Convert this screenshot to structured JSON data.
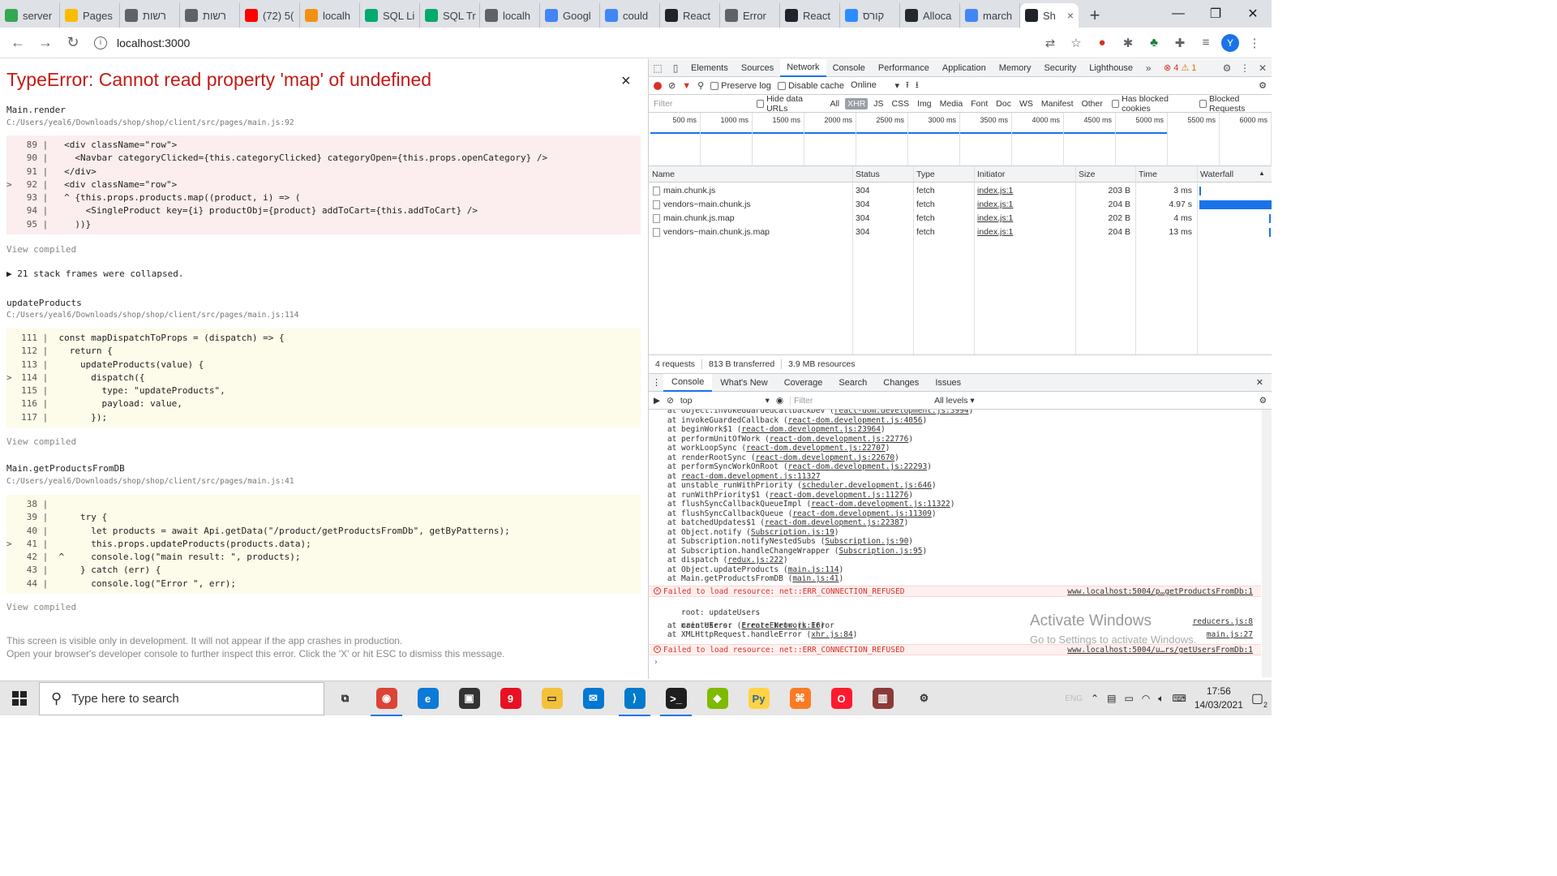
{
  "browser": {
    "tabs": [
      {
        "label": "server",
        "icon": "google-drive-icon",
        "color": "#34a853"
      },
      {
        "label": "Pages",
        "icon": "google-drive-icon",
        "color": "#fbbc04"
      },
      {
        "label": "רשות",
        "icon": "globe-icon",
        "color": "#5f6368"
      },
      {
        "label": "רשות",
        "icon": "globe-icon",
        "color": "#5f6368"
      },
      {
        "label": "(72) 5(",
        "icon": "youtube-icon",
        "color": "#ff0000"
      },
      {
        "label": "localh",
        "icon": "phpmyadmin-icon",
        "color": "#f29111"
      },
      {
        "label": "SQL Li",
        "icon": "w3schools-icon",
        "color": "#04aa6d"
      },
      {
        "label": "SQL Tr",
        "icon": "w3schools-icon",
        "color": "#04aa6d"
      },
      {
        "label": "localh",
        "icon": "globe-icon",
        "color": "#5f6368"
      },
      {
        "label": "Googl",
        "icon": "google-translate-icon",
        "color": "#4285f4"
      },
      {
        "label": "could",
        "icon": "google-icon",
        "color": "#4285f4"
      },
      {
        "label": "React",
        "icon": "react-icon",
        "color": "#20232a"
      },
      {
        "label": "Error",
        "icon": "globe-icon",
        "color": "#5f6368"
      },
      {
        "label": "React",
        "icon": "react-icon",
        "color": "#20232a"
      },
      {
        "label": "קורס",
        "icon": "zoom-icon",
        "color": "#2d8cff"
      },
      {
        "label": "Alloca",
        "icon": "github-icon",
        "color": "#24292e"
      },
      {
        "label": "march",
        "icon": "google-icon",
        "color": "#4285f4"
      },
      {
        "label": "Sh",
        "icon": "react-icon",
        "color": "#20232a",
        "active": true
      }
    ],
    "url": "localhost:3000",
    "profile_initial": "Y"
  },
  "overlay": {
    "title": "TypeError: Cannot read property 'map' of undefined",
    "close_glyph": "×",
    "frames": [
      {
        "name": "Main.render",
        "path": "C:/Users/yeal6/Downloads/shop/shop/client/src/pages/main.js:92",
        "style": "red",
        "lines": [
          {
            "ln": "89",
            "mark": "",
            "code": "  <div className=\"row\">"
          },
          {
            "ln": "90",
            "mark": "",
            "code": "    <Navbar categoryClicked={this.categoryClicked} categoryOpen={this.props.openCategory} />"
          },
          {
            "ln": "91",
            "mark": "",
            "code": "  </div>"
          },
          {
            "ln": "92",
            "mark": ">",
            "code": "  <div className=\"row\">"
          },
          {
            "ln": "93",
            "mark": "",
            "code": "  ^ {this.props.products.map((product, i) => ("
          },
          {
            "ln": "94",
            "mark": "",
            "code": "      <SingleProduct key={i} productObj={product} addToCart={this.addToCart} />"
          },
          {
            "ln": "95",
            "mark": "",
            "code": "    ))}"
          }
        ]
      },
      {
        "name": "updateProducts",
        "path": "C:/Users/yeal6/Downloads/shop/shop/client/src/pages/main.js:114",
        "style": "yellow",
        "lines": [
          {
            "ln": "111",
            "mark": "",
            "code": " const mapDispatchToProps = (dispatch) => {"
          },
          {
            "ln": "112",
            "mark": "",
            "code": "   return {"
          },
          {
            "ln": "113",
            "mark": "",
            "code": "     updateProducts(value) {"
          },
          {
            "ln": "114",
            "mark": ">",
            "code": "       dispatch({"
          },
          {
            "ln": "115",
            "mark": "",
            "code": "         type: \"updateProducts\","
          },
          {
            "ln": "116",
            "mark": "",
            "code": "         payload: value,"
          },
          {
            "ln": "117",
            "mark": "",
            "code": "       });"
          }
        ]
      },
      {
        "name": "Main.getProductsFromDB",
        "path": "C:/Users/yeal6/Downloads/shop/shop/client/src/pages/main.js:41",
        "style": "yellow",
        "lines": [
          {
            "ln": "38",
            "mark": "",
            "code": ""
          },
          {
            "ln": "39",
            "mark": "",
            "code": "     try {"
          },
          {
            "ln": "40",
            "mark": "",
            "code": "       let products = await Api.getData(\"/product/getProductsFromDb\", getByPatterns);"
          },
          {
            "ln": "41",
            "mark": ">",
            "code": "       this.props.updateProducts(products.data);"
          },
          {
            "ln": "42",
            "mark": "",
            "code": " ^     console.log(\"main result: \", products);"
          },
          {
            "ln": "43",
            "mark": "",
            "code": "     } catch (err) {"
          },
          {
            "ln": "44",
            "mark": "",
            "code": "       console.log(\"Error \", err);"
          }
        ]
      }
    ],
    "view_compiled": "View compiled",
    "collapsed": "▶ 21 stack frames were collapsed.",
    "footer_line1": "This screen is visible only in development. It will not appear if the app crashes in production.",
    "footer_line2": "Open your browser's developer console to further inspect this error.  Click the 'X' or hit ESC to dismiss this message."
  },
  "devtools": {
    "tabs": [
      "Elements",
      "Sources",
      "Network",
      "Console",
      "Performance",
      "Application",
      "Memory",
      "Security",
      "Lighthouse"
    ],
    "active_tab": "Network",
    "more_glyph": "»",
    "error_count": "4",
    "warning_count": "1",
    "net_toolbar": {
      "preserve_log": "Preserve log",
      "disable_cache": "Disable cache",
      "throttle": "Online"
    },
    "filter_row": {
      "placeholder": "Filter",
      "hide_data_urls": "Hide data URLs",
      "types": [
        "All",
        "XHR",
        "JS",
        "CSS",
        "Img",
        "Media",
        "Font",
        "Doc",
        "WS",
        "Manifest",
        "Other"
      ],
      "selected_type": "XHR",
      "has_blocked_cookies": "Has blocked cookies",
      "blocked_requests": "Blocked Requests"
    },
    "timeline_ticks": [
      "500 ms",
      "1000 ms",
      "1500 ms",
      "2000 ms",
      "2500 ms",
      "3000 ms",
      "3500 ms",
      "4000 ms",
      "4500 ms",
      "5000 ms",
      "5500 ms",
      "6000 ms"
    ],
    "table": {
      "headers": [
        "Name",
        "Status",
        "Type",
        "Initiator",
        "Size",
        "Time",
        "Waterfall"
      ],
      "rows": [
        {
          "name": "main.chunk.js",
          "status": "304",
          "type": "fetch",
          "initiator": "index.js:1",
          "size": "203 B",
          "time": "3 ms"
        },
        {
          "name": "vendors~main.chunk.js",
          "status": "304",
          "type": "fetch",
          "initiator": "index.js:1",
          "size": "204 B",
          "time": "4.97 s"
        },
        {
          "name": "main.chunk.js.map",
          "status": "304",
          "type": "fetch",
          "initiator": "index.js:1",
          "size": "202 B",
          "time": "4 ms"
        },
        {
          "name": "vendors~main.chunk.js.map",
          "status": "304",
          "type": "fetch",
          "initiator": "index.js:1",
          "size": "204 B",
          "time": "13 ms"
        }
      ]
    },
    "summary": [
      "4 requests",
      "813 B transferred",
      "3.9 MB resources"
    ],
    "drawer_tabs": [
      "Console",
      "What's New",
      "Coverage",
      "Search",
      "Changes",
      "Issues"
    ],
    "console_toolbar": {
      "context": "top",
      "filter_placeholder": "Filter",
      "levels": "All levels ▾"
    },
    "stack_lines": [
      {
        "pre": "    at Object.invokeGuardedCallbackDev (",
        "link": "react-dom.development.js:3994",
        "post": ")"
      },
      {
        "pre": "    at invokeGuardedCallback (",
        "link": "react-dom.development.js:4056",
        "post": ")"
      },
      {
        "pre": "    at beginWork$1 (",
        "link": "react-dom.development.js:23964",
        "post": ")"
      },
      {
        "pre": "    at performUnitOfWork (",
        "link": "react-dom.development.js:22776",
        "post": ")"
      },
      {
        "pre": "    at workLoopSync (",
        "link": "react-dom.development.js:22707",
        "post": ")"
      },
      {
        "pre": "    at renderRootSync (",
        "link": "react-dom.development.js:22670",
        "post": ")"
      },
      {
        "pre": "    at performSyncWorkOnRoot (",
        "link": "react-dom.development.js:22293",
        "post": ")"
      },
      {
        "pre": "    at ",
        "link": "react-dom.development.js:11327",
        "post": ""
      },
      {
        "pre": "    at unstable_runWithPriority (",
        "link": "scheduler.development.js:646",
        "post": ")"
      },
      {
        "pre": "    at runWithPriority$1 (",
        "link": "react-dom.development.js:11276",
        "post": ")"
      },
      {
        "pre": "    at flushSyncCallbackQueueImpl (",
        "link": "react-dom.development.js:11322",
        "post": ")"
      },
      {
        "pre": "    at flushSyncCallbackQueue (",
        "link": "react-dom.development.js:11309",
        "post": ")"
      },
      {
        "pre": "    at batchedUpdates$1 (",
        "link": "react-dom.development.js:22387",
        "post": ")"
      },
      {
        "pre": "    at Object.notify (",
        "link": "Subscription.js:19",
        "post": ")"
      },
      {
        "pre": "    at Subscription.notifyNestedSubs (",
        "link": "Subscription.js:90",
        "post": ")"
      },
      {
        "pre": "    at Subscription.handleChangeWrapper (",
        "link": "Subscription.js:95",
        "post": ")"
      },
      {
        "pre": "    at dispatch (",
        "link": "redux.js:222",
        "post": ")"
      },
      {
        "pre": "    at Object.updateProducts (",
        "link": "main.js:114",
        "post": ")"
      },
      {
        "pre": "    at Main.getProductsFromDB (",
        "link": "main.js:41",
        "post": ")"
      }
    ],
    "errors": [
      {
        "msg": "Failed to load resource: net::ERR_CONNECTION_REFUSED",
        "src": "www.localhost:5004/p…getProductsFromDb:1"
      },
      {
        "msg": "Failed to load resource: net::ERR_CONNECTION_REFUSED",
        "src": "www.localhost:5004/u…rs/getUsersFromDb:1"
      }
    ],
    "log_root": {
      "text": " root: updateUsers",
      "src": "reducers.js:8"
    },
    "log_main": {
      "text": " main Users:  Error: Network Error",
      "src": "main.js:27",
      "l2_pre": "    at createError (",
      "l2_link": "createError.js:16",
      "l2_post": ")",
      "l3_pre": "    at XMLHttpRequest.handleError (",
      "l3_link": "xhr.js:84",
      "l3_post": ")"
    },
    "prompt": "›",
    "watermark_1": "Activate Windows",
    "watermark_2": "Go to Settings to activate Windows."
  },
  "taskbar": {
    "search_placeholder": "Type here to search",
    "apps": [
      {
        "name": "task-view",
        "glyph": "⧉",
        "color": "#e6e6e6",
        "fg": "#222"
      },
      {
        "name": "chrome",
        "glyph": "◉",
        "color": "#db4437",
        "fg": "#fff",
        "open": true
      },
      {
        "name": "edge",
        "glyph": "e",
        "color": "#0c7ad8",
        "fg": "#fff"
      },
      {
        "name": "store",
        "glyph": "▣",
        "color": "#333",
        "fg": "#fff"
      },
      {
        "name": "phone",
        "glyph": "9",
        "color": "#e81123",
        "fg": "#fff"
      },
      {
        "name": "file-explorer",
        "glyph": "▭",
        "color": "#f3c13a",
        "fg": "#333"
      },
      {
        "name": "mail",
        "glyph": "✉",
        "color": "#0078d4",
        "fg": "#fff"
      },
      {
        "name": "vscode",
        "glyph": "⟩",
        "color": "#007acc",
        "fg": "#fff",
        "open": true
      },
      {
        "name": "terminal",
        "glyph": ">_",
        "color": "#1e1e1e",
        "fg": "#fff",
        "open": true
      },
      {
        "name": "gitkraken",
        "glyph": "◆",
        "color": "#7fba00",
        "fg": "#fff"
      },
      {
        "name": "python",
        "glyph": "Py",
        "color": "#ffd343",
        "fg": "#306998"
      },
      {
        "name": "xampp",
        "glyph": "⌘",
        "color": "#fb7a24",
        "fg": "#fff"
      },
      {
        "name": "opera",
        "glyph": "O",
        "color": "#ff1b2d",
        "fg": "#fff"
      },
      {
        "name": "winrar",
        "glyph": "▥",
        "color": "#8b3a3a",
        "fg": "#fff"
      },
      {
        "name": "settings",
        "glyph": "⚙",
        "color": "#e6e6e6",
        "fg": "#333"
      }
    ],
    "lang": "ENG",
    "time": "17:56",
    "date": "14/03/2021",
    "notif_count": "2"
  }
}
